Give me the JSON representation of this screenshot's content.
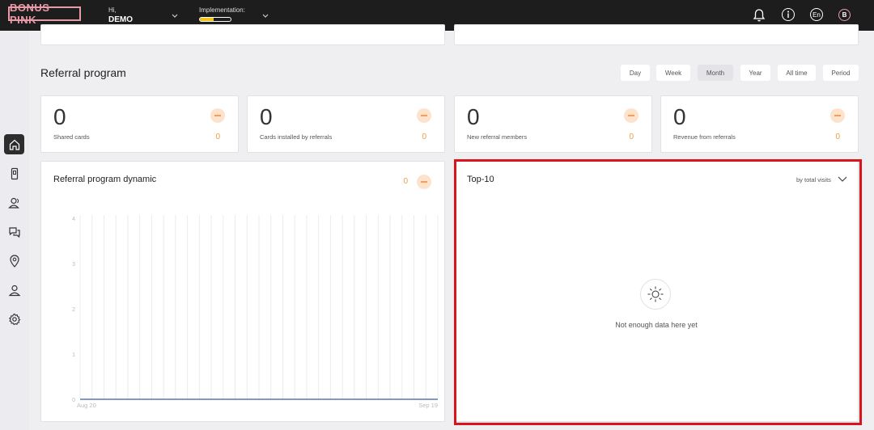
{
  "header": {
    "logo": "BONUS PINK",
    "greeting": "Hi,",
    "username": "DEMO",
    "implementation_label": "Implementation:",
    "implementation_progress": 0.45,
    "language": "En",
    "avatar_letter": "B"
  },
  "sidebar": {
    "items": [
      {
        "icon": "home-icon",
        "active": true
      },
      {
        "icon": "phone-card-icon",
        "active": false
      },
      {
        "icon": "users-icon",
        "active": false
      },
      {
        "icon": "chat-icon",
        "active": false
      },
      {
        "icon": "location-icon",
        "active": false
      },
      {
        "icon": "person-icon",
        "active": false
      },
      {
        "icon": "gear-icon",
        "active": false
      }
    ]
  },
  "section": {
    "title": "Referral program",
    "periods": [
      "Day",
      "Week",
      "Month",
      "Year",
      "All time",
      "Period"
    ],
    "active_period": "Month"
  },
  "stats": [
    {
      "value": "0",
      "label": "Shared cards",
      "change": "0"
    },
    {
      "value": "0",
      "label": "Cards installed by referrals",
      "change": "0"
    },
    {
      "value": "0",
      "label": "New referral members",
      "change": "0"
    },
    {
      "value": "0",
      "label": "Revenue from referrals",
      "change": "0"
    }
  ],
  "dynamic": {
    "title": "Referral program dynamic",
    "change": "0"
  },
  "chart_data": {
    "type": "line",
    "x": [
      "Aug 20",
      "Sep 19"
    ],
    "series": [
      {
        "values": [
          0,
          0
        ]
      }
    ],
    "yticks": [
      0,
      1,
      2,
      3,
      4
    ],
    "ylim": [
      0,
      4
    ],
    "grid": true,
    "vertical_gridlines": 31
  },
  "top10": {
    "title": "Top-10",
    "sort_label": "by total visits",
    "empty_text": "Not enough data here yet"
  },
  "colors": {
    "header_bg": "#1d1d1d",
    "accent_orange": "#e8a040",
    "badge_bg": "#fde3cc",
    "logo_pink": "#e89aa7",
    "highlight_red": "#d9141d"
  }
}
